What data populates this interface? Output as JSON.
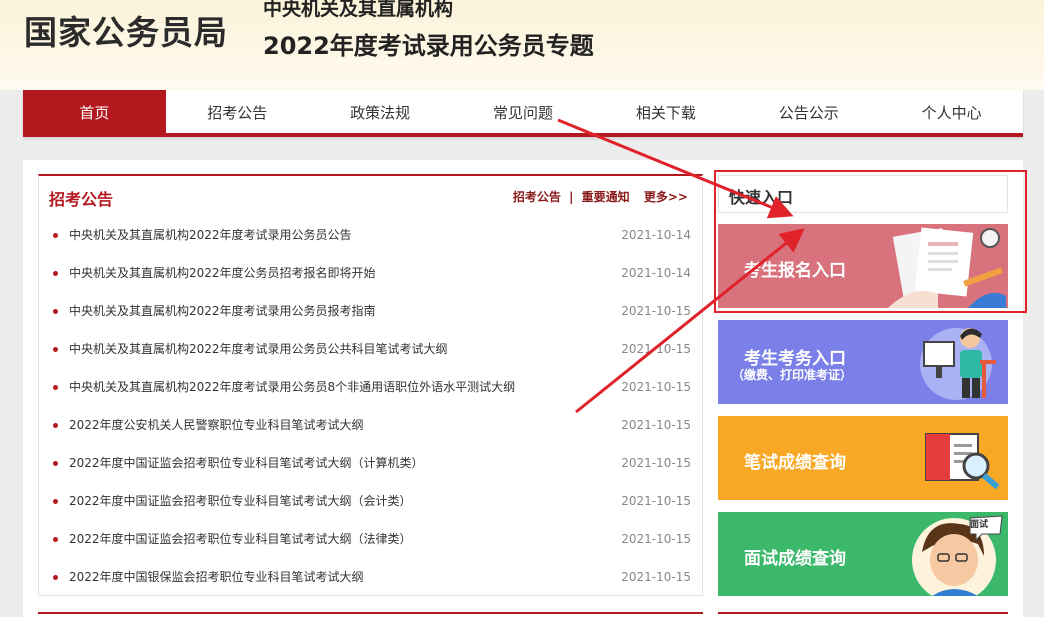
{
  "header": {
    "logo": "国家公务员局",
    "subtitle_line1": "中央机关及其直属机构",
    "subtitle_line2": "2022年度考试录用公务员专题"
  },
  "nav": {
    "items": [
      "首页",
      "招考公告",
      "政策法规",
      "常见问题",
      "相关下载",
      "公告公示",
      "个人中心"
    ],
    "active_index": 0
  },
  "news": {
    "title": "招考公告",
    "tab1": "招考公告",
    "separator": "|",
    "tab2": "重要通知",
    "more": "更多>>",
    "items": [
      {
        "title": "中央机关及其直属机构2022年度考试录用公务员公告",
        "date": "2021-10-14"
      },
      {
        "title": "中央机关及其直属机构2022年度公务员招考报名即将开始",
        "date": "2021-10-14"
      },
      {
        "title": "中央机关及其直属机构2022年度考试录用公务员报考指南",
        "date": "2021-10-15"
      },
      {
        "title": "中央机关及其直属机构2022年度考试录用公务员公共科目笔试考试大纲",
        "date": "2021-10-15"
      },
      {
        "title": "中央机关及其直属机构2022年度考试录用公务员8个非通用语职位外语水平测试大纲",
        "date": "2021-10-15"
      },
      {
        "title": "2022年度公安机关人民警察职位专业科目笔试考试大纲",
        "date": "2021-10-15"
      },
      {
        "title": "2022年度中国证监会招考职位专业科目笔试考试大纲（计算机类）",
        "date": "2021-10-15"
      },
      {
        "title": "2022年度中国证监会招考职位专业科目笔试考试大纲（会计类）",
        "date": "2021-10-15"
      },
      {
        "title": "2022年度中国证监会招考职位专业科目笔试考试大纲（法律类）",
        "date": "2021-10-15"
      },
      {
        "title": "2022年度中国银保监会招考职位专业科目笔试考试大纲",
        "date": "2021-10-15"
      }
    ]
  },
  "quick": {
    "title": "快速入口",
    "cards": [
      {
        "label": "考生报名入口",
        "sub": "",
        "color": "#d8727c"
      },
      {
        "label": "考生考务入口",
        "sub": "（缴费、打印准考证）",
        "color": "#7b7fe8"
      },
      {
        "label": "笔试成绩查询",
        "sub": "",
        "color": "#f9a825"
      },
      {
        "label": "面试成绩查询",
        "sub": "",
        "color": "#3cb86b",
        "badge": "面试"
      }
    ]
  },
  "colors": {
    "brand_red": "#b4181f",
    "annotation_red": "#e0222a"
  }
}
